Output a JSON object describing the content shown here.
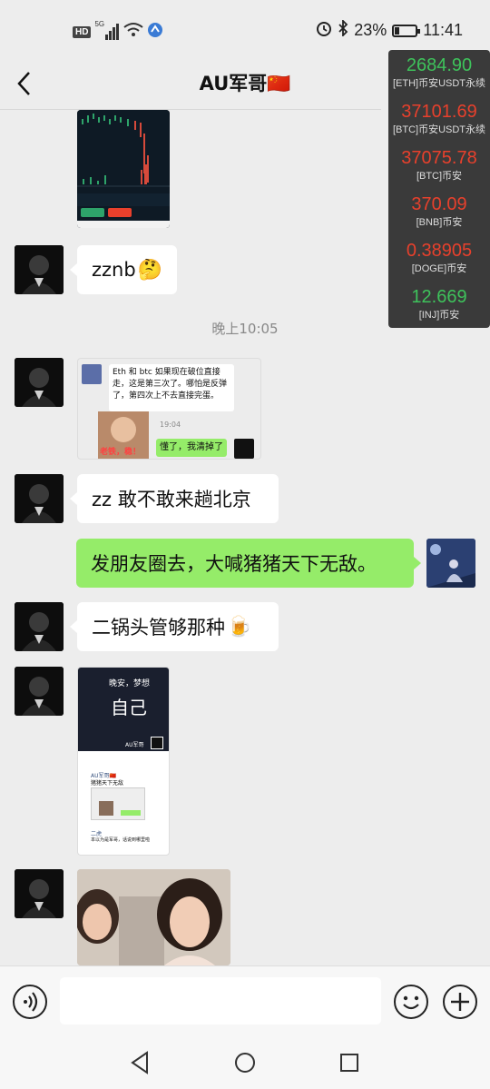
{
  "status_bar": {
    "network_badge": "HD",
    "signal_label": "5G",
    "battery_text": "23%",
    "battery_level": 0.23,
    "time": "11:41"
  },
  "header": {
    "title": "AU军哥🇨🇳"
  },
  "ticker": [
    {
      "price": "2684.90",
      "label": "[ETH]币安USDT永续",
      "trend": "up"
    },
    {
      "price": "37101.69",
      "label": "[BTC]币安USDT永续",
      "trend": "down"
    },
    {
      "price": "37075.78",
      "label": "[BTC]币安",
      "trend": "down"
    },
    {
      "price": "370.09",
      "label": "[BNB]币安",
      "trend": "down"
    },
    {
      "price": "0.38905",
      "label": "[DOGE]币安",
      "trend": "down"
    },
    {
      "price": "12.669",
      "label": "[INJ]币安",
      "trend": "up"
    }
  ],
  "messages": {
    "m1": {
      "text": "zznb",
      "emoji": "🤔"
    },
    "timestamp": "晚上10:05",
    "screenshot1": {
      "quote_text": "Eth 和 btc 如果现在破位直接走，这是第三次了。哪怕是反弹了，第四次上不去直接完蛋。",
      "time": "19:04",
      "reply_text": "懂了，我清掉了",
      "caption": "老铁，稳！"
    },
    "m2": {
      "text": "zz 敢不敢来趟北京"
    },
    "m3": {
      "text": "发朋友圈去，大喊猪猪天下无敌。"
    },
    "m4": {
      "text": "二锅头管够那种",
      "emoji": "🍺"
    },
    "screenshot2": {
      "poster_line1": "晚安，梦想",
      "poster_line2": "自己",
      "poster_name": "AU军哥",
      "comment_name": "AU军哥🇨🇳",
      "comment_text": "猪猪天下无敌",
      "reply_name": "二虎",
      "reply_text": "本以为是军哥，话说到哪里啦"
    }
  },
  "colors": {
    "background": "#ededed",
    "bubble_self": "#95ec69",
    "ticker_up": "#3ec25b",
    "ticker_down": "#e8402c",
    "ticker_bg": "#3a3a3a"
  },
  "icons": {
    "back": "chevron-left-icon",
    "voice": "voice-icon",
    "emoji": "smile-icon",
    "add": "plus-icon",
    "nav_back": "triangle-back-icon",
    "nav_home": "circle-home-icon",
    "nav_recent": "square-recent-icon"
  }
}
